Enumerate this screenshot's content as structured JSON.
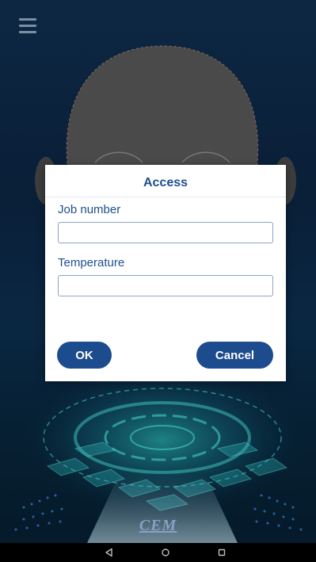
{
  "app": {
    "menu_icon": "hamburger-menu-icon",
    "brand": "CEM"
  },
  "dialog": {
    "title": "Access",
    "fields": [
      {
        "label": "Job number",
        "value": "",
        "placeholder": ""
      },
      {
        "label": "Temperature",
        "value": "",
        "placeholder": ""
      }
    ],
    "ok_label": "OK",
    "cancel_label": "Cancel"
  },
  "navbar": {
    "back_icon": "back-triangle-icon",
    "home_icon": "home-circle-icon",
    "recent_icon": "recent-apps-square-icon"
  },
  "colors": {
    "accent": "#1c4b8e",
    "label": "#1e4f8c",
    "background": "#0a1f38"
  }
}
